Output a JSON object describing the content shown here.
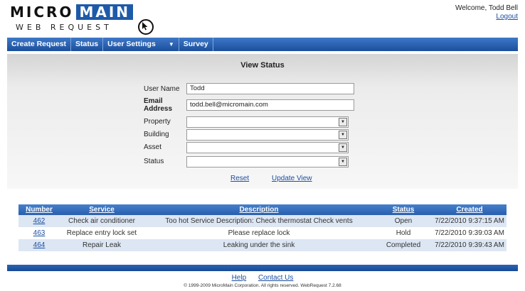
{
  "header": {
    "logo_word1": "MICRO",
    "logo_word2": "MAIN",
    "logo_sub": "WEB REQUEST",
    "welcome": "Welcome, Todd Bell",
    "logout": "Logout"
  },
  "nav": {
    "items": [
      "Create Request",
      "Status",
      "User Settings",
      "Survey"
    ],
    "dropdown_caret": "▼"
  },
  "form": {
    "title": "View Status",
    "user_name_label": "User Name",
    "user_name_value": "Todd",
    "email_label": "Email Address",
    "email_value": "todd.bell@micromain.com",
    "property_label": "Property",
    "building_label": "Building",
    "asset_label": "Asset",
    "status_label": "Status",
    "reset": "Reset",
    "update": "Update View"
  },
  "table": {
    "headers": [
      "Number",
      "Service",
      "Description",
      "Status",
      "Created"
    ],
    "rows": [
      [
        "462",
        "Check air conditioner",
        "Too hot Service Description: Check thermostat Check vents",
        "Open",
        "7/22/2010 9:37:15 AM"
      ],
      [
        "463",
        "Replace entry lock set",
        "Please replace lock",
        "Hold",
        "7/22/2010 9:39:03 AM"
      ],
      [
        "464",
        "Repair Leak",
        "Leaking under the sink",
        "Completed",
        "7/22/2010 9:39:43 AM"
      ]
    ]
  },
  "footer": {
    "help": "Help",
    "contact": "Contact Us",
    "copyright": "© 1999-2009 MicroMain Corporation. All rights reserved. WebRequest 7.2.68"
  },
  "colors": {
    "brand_blue": "#1e5aa8",
    "nav_blue": "#2a5fae",
    "row_alt": "#dde6f3"
  }
}
